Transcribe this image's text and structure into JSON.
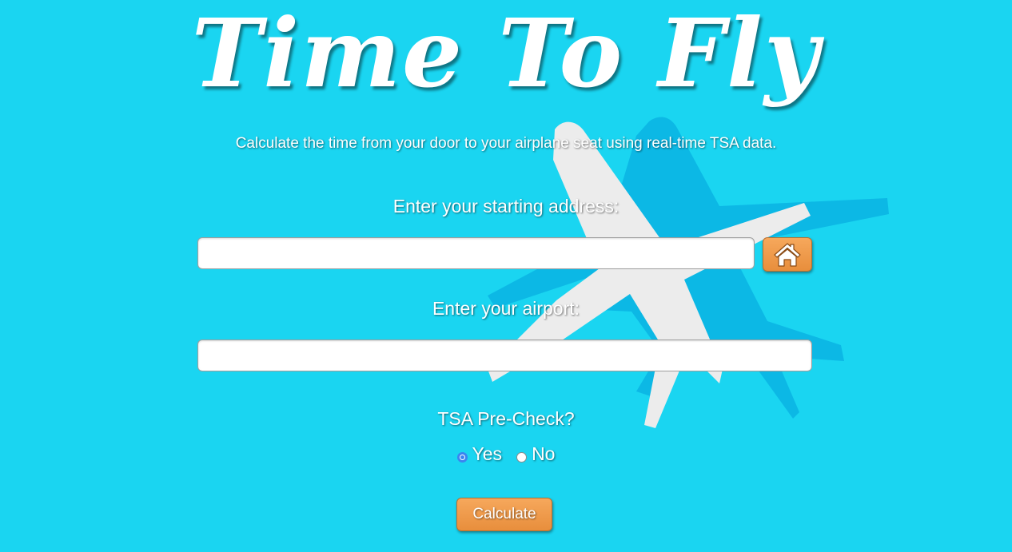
{
  "header": {
    "title": "Time To Fly",
    "subtitle": "Calculate the time from your door to your airplane seat using real-time TSA data."
  },
  "form": {
    "address_label": "Enter your starting address:",
    "address_value": "",
    "home_button_icon": "home-icon",
    "airport_label": "Enter your airport:",
    "airport_value": "",
    "tsa_label": "TSA Pre-Check?",
    "tsa_options": [
      {
        "label": "Yes",
        "checked": true
      },
      {
        "label": "No",
        "checked": false
      }
    ],
    "calculate_label": "Calculate"
  },
  "colors": {
    "background": "#1ad5f1",
    "button": "#ee9a4a",
    "radio_accent": "#3b84f0"
  },
  "background_image": "airplane-silhouette"
}
